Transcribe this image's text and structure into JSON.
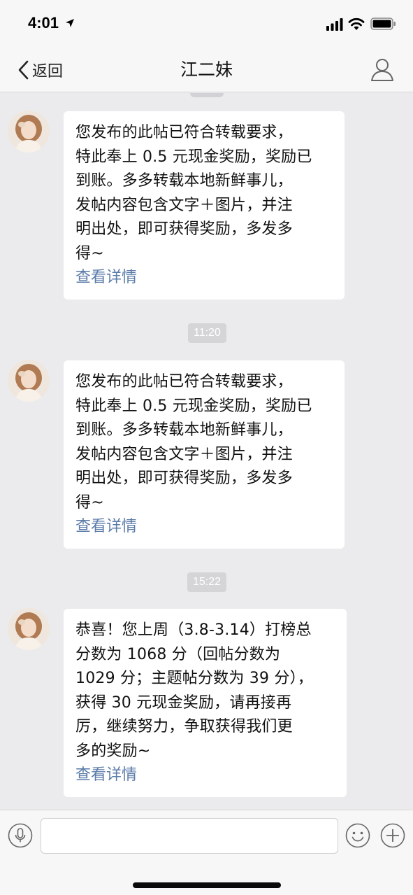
{
  "status_bar": {
    "time": "4:01"
  },
  "nav": {
    "back_label": "返回",
    "title": "江二妹"
  },
  "messages": [
    {
      "text": "您发布的此帖已符合转载要求，\n特此奉上 0.5 元现金奖励，奖励已\n到账。多多转载本地新鲜事儿，\n发帖内容包含文字＋图片，并注\n明出处，即可获得奖励，多发多\n得~",
      "link": "查看详情"
    },
    {
      "timestamp": "11:20",
      "text": "您发布的此帖已符合转载要求，\n特此奉上 0.5 元现金奖励，奖励已\n到账。多多转载本地新鲜事儿，\n发帖内容包含文字＋图片，并注\n明出处，即可获得奖励，多发多\n得~",
      "link": "查看详情"
    },
    {
      "timestamp": "15:22",
      "text": "恭喜！您上周（3.8-3.14）打榜总\n分数为 1068 分（回帖分数为\n1029 分；主题帖分数为 39 分），\n获得 30 元现金奖励，请再接再\n厉，继续努力，争取获得我们更\n多的奖励~",
      "link": "查看详情"
    }
  ],
  "input_bar": {
    "placeholder": ""
  },
  "colors": {
    "link": "#5a7ba8",
    "background": "#ebebed",
    "bubble": "#ffffff"
  },
  "icons": [
    "location-arrow-icon",
    "signal-icon",
    "wifi-icon",
    "battery-icon",
    "chevron-left-icon",
    "person-icon",
    "microphone-icon",
    "smiley-icon",
    "plus-icon"
  ]
}
